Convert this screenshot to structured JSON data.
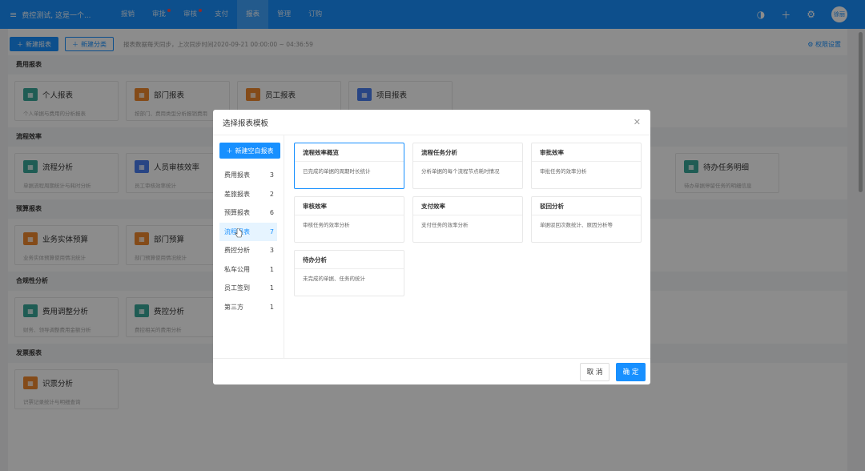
{
  "topbar": {
    "brand": "费控测试, 这是一个...",
    "nav": [
      {
        "label": "报销",
        "dot": false,
        "active": false
      },
      {
        "label": "审批",
        "dot": true,
        "active": false
      },
      {
        "label": "审核",
        "dot": true,
        "active": false
      },
      {
        "label": "支付",
        "dot": false,
        "active": false
      },
      {
        "label": "报表",
        "dot": false,
        "active": true
      },
      {
        "label": "管理",
        "dot": false,
        "active": false
      },
      {
        "label": "订购",
        "dot": false,
        "active": false
      }
    ],
    "avatar": "徐丽"
  },
  "toolbar": {
    "new_report": "新建报表",
    "new_category": "新建分类",
    "sync_note": "报表数据每天同步，上次同步时间2020-09-21 00:00:00 ~ 04:36:59",
    "permissions": "权限设置"
  },
  "sections": [
    {
      "title": "费用报表",
      "cards": [
        {
          "title": "个人报表",
          "desc": "个人单据与费用的分析报表",
          "color": "#3aa89a"
        },
        {
          "title": "部门报表",
          "desc": "按部门、费用类型分析报销费用",
          "color": "#f0892e"
        },
        {
          "title": "员工报表",
          "desc": "",
          "color": "#f0892e"
        },
        {
          "title": "项目报表",
          "desc": "",
          "color": "#4a7ff0"
        }
      ]
    },
    {
      "title": "流程效率",
      "cards": [
        {
          "title": "流程分析",
          "desc": "单据流程周期统计与耗时分析",
          "color": "#3aa89a"
        },
        {
          "title": "人员审核效率",
          "desc": "员工审核效率统计",
          "color": "#4a7ff0"
        }
      ],
      "extra_card": {
        "title": "待办任务明细",
        "desc": "待办单据停留任务的明细信息",
        "color": "#3aa89a"
      }
    },
    {
      "title": "预算报表",
      "cards": [
        {
          "title": "业务实体预算",
          "desc": "业务实体预算使用情况统计",
          "color": "#f0892e"
        },
        {
          "title": "部门预算",
          "desc": "部门预算使用情况统计",
          "color": "#f0892e"
        }
      ]
    },
    {
      "title": "合规性分析",
      "cards": [
        {
          "title": "费用调整分析",
          "desc": "财务、领导调整费用金额分析",
          "color": "#3aa89a"
        },
        {
          "title": "费控分析",
          "desc": "费控相关的费用分析",
          "color": "#3aa89a"
        }
      ]
    },
    {
      "title": "发票报表",
      "cards": [
        {
          "title": "识票分析",
          "desc": "识票记录统计与明细查询",
          "color": "#f0892e"
        }
      ]
    }
  ],
  "modal": {
    "title": "选择报表模板",
    "new_blank": "新建空白报表",
    "categories": [
      {
        "label": "费用报表",
        "count": "3"
      },
      {
        "label": "差旅报表",
        "count": "2"
      },
      {
        "label": "预算报表",
        "count": "6"
      },
      {
        "label": "流程报表",
        "count": "7"
      },
      {
        "label": "费控分析",
        "count": "3"
      },
      {
        "label": "私车公用",
        "count": "1"
      },
      {
        "label": "员工签到",
        "count": "1"
      },
      {
        "label": "第三方",
        "count": "1"
      }
    ],
    "active_category_index": 3,
    "templates": [
      {
        "title": "流程效率概览",
        "desc": "已完成的单据的周期时长统计",
        "selected": true
      },
      {
        "title": "流程任务分析",
        "desc": "分析单据的每个流程节点耗时情况",
        "selected": false
      },
      {
        "title": "审批效率",
        "desc": "审批任务的效率分析",
        "selected": false
      },
      {
        "title": "审核效率",
        "desc": "审核任务的效率分析",
        "selected": false
      },
      {
        "title": "支付效率",
        "desc": "支付任务的效率分析",
        "selected": false
      },
      {
        "title": "驳回分析",
        "desc": "单据驳回次数统计、原因分析等",
        "selected": false
      },
      {
        "title": "待办分析",
        "desc": "未完成的单据、任务的统计",
        "selected": false
      }
    ],
    "cancel": "取 消",
    "ok": "确 定"
  },
  "colors": {
    "accent": "#1890ff",
    "mask": "rgba(0,0,0,0.45)"
  }
}
